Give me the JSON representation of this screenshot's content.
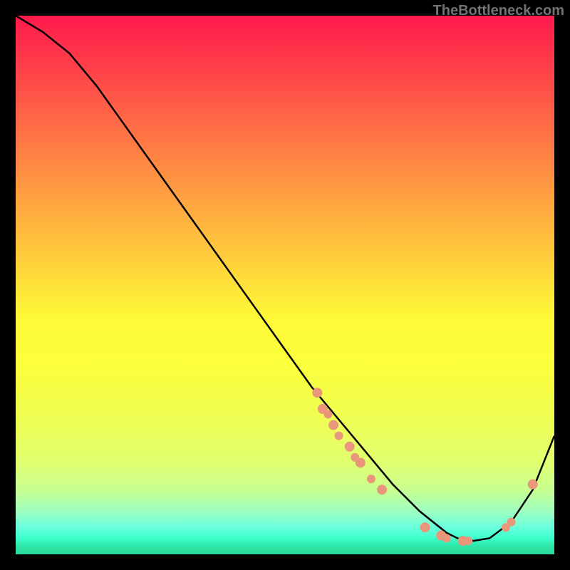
{
  "watermark": "TheBottleneck.com",
  "chart_data": {
    "type": "line",
    "title": "",
    "xlabel": "",
    "ylabel": "",
    "xlim": [
      0,
      100
    ],
    "ylim": [
      0,
      100
    ],
    "series": [
      {
        "name": "curve",
        "x": [
          0,
          5,
          10,
          15,
          20,
          25,
          30,
          35,
          40,
          45,
          50,
          55,
          60,
          65,
          70,
          75,
          80,
          82,
          85,
          88,
          92,
          96,
          100
        ],
        "y": [
          100,
          97,
          93,
          87,
          80,
          73,
          66,
          59,
          52,
          45,
          38,
          31,
          25,
          19,
          13,
          8,
          4,
          3,
          2.5,
          3,
          6,
          12,
          22
        ]
      }
    ],
    "markers": [
      {
        "x": 56,
        "y": 30,
        "r": 7
      },
      {
        "x": 57,
        "y": 27,
        "r": 7
      },
      {
        "x": 58,
        "y": 26,
        "r": 6
      },
      {
        "x": 59,
        "y": 24,
        "r": 7
      },
      {
        "x": 60,
        "y": 22,
        "r": 6
      },
      {
        "x": 62,
        "y": 20,
        "r": 7
      },
      {
        "x": 63,
        "y": 18,
        "r": 6
      },
      {
        "x": 64,
        "y": 17,
        "r": 7
      },
      {
        "x": 66,
        "y": 14,
        "r": 6
      },
      {
        "x": 68,
        "y": 12,
        "r": 7
      },
      {
        "x": 76,
        "y": 5,
        "r": 7
      },
      {
        "x": 79,
        "y": 3.5,
        "r": 7
      },
      {
        "x": 80,
        "y": 3,
        "r": 6
      },
      {
        "x": 83,
        "y": 2.5,
        "r": 7
      },
      {
        "x": 84,
        "y": 2.5,
        "r": 6
      },
      {
        "x": 91,
        "y": 5,
        "r": 6
      },
      {
        "x": 92,
        "y": 6,
        "r": 6
      },
      {
        "x": 96,
        "y": 13,
        "r": 7
      }
    ],
    "marker_color": "#e9967a",
    "curve_color": "#000000"
  }
}
